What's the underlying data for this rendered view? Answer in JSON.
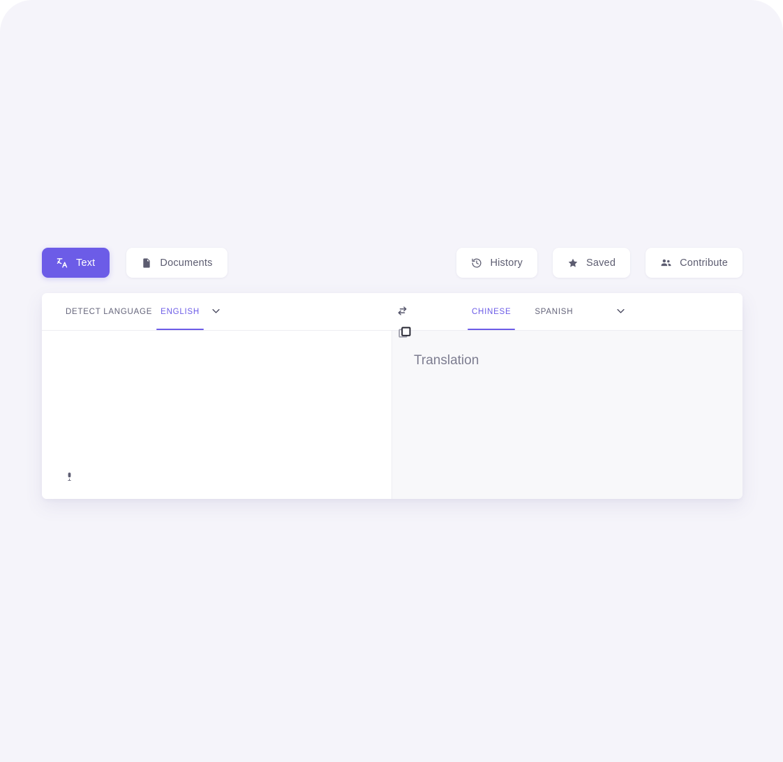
{
  "theme": {
    "accent": "#6c5ce7",
    "page_bg": "#f5f4fa",
    "card_bg": "#ffffff",
    "target_pane_bg": "#f8f8fa",
    "muted_text": "#64647a"
  },
  "toolbar": {
    "left_buttons": [
      {
        "label": "Text",
        "icon": "translate-icon",
        "active": true
      },
      {
        "label": "Documents",
        "icon": "document-icon",
        "active": false
      }
    ],
    "right_buttons": [
      {
        "label": "History",
        "icon": "history-icon"
      },
      {
        "label": "Saved",
        "icon": "star-icon"
      },
      {
        "label": "Contribute",
        "icon": "people-icon"
      }
    ]
  },
  "translator": {
    "source": {
      "tabs": [
        {
          "label": "DETECT LANGUAGE",
          "selected": false
        },
        {
          "label": "ENGLISH",
          "selected": true
        }
      ],
      "more_icon": "chevron-down-icon",
      "input_value": "",
      "input_placeholder": "",
      "mic_icon": "microphone-icon"
    },
    "swap_icon": "swap-horizontal-icon",
    "target": {
      "tabs": [
        {
          "label": "CHINESE",
          "selected": true
        },
        {
          "label": "SPANISH",
          "selected": false
        }
      ],
      "more_icon": "chevron-down-icon",
      "copy_icon": "copy-icon",
      "placeholder": "Translation"
    }
  }
}
